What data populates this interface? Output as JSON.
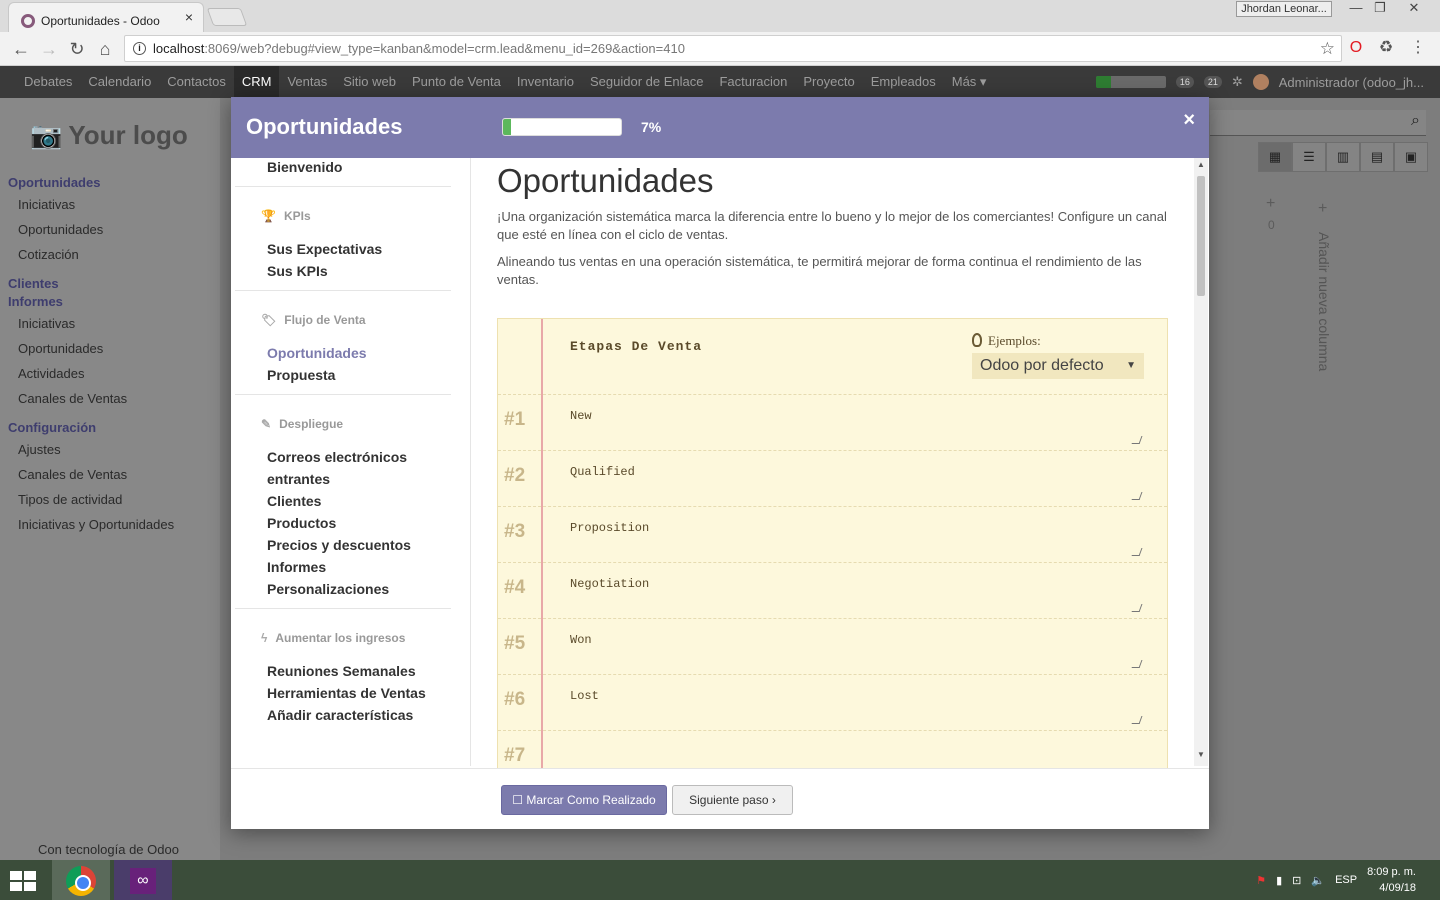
{
  "browser": {
    "tab_title": "Oportunidades - Odoo",
    "tab_close": "×",
    "user_badge": "Jhordan Leonar...",
    "url_host": "localhost",
    "url_rest": ":8069/web?debug#view_type=kanban&model=crm.lead&menu_id=269&action=410",
    "win_min": "—",
    "win_max": "❐",
    "win_close": "✕"
  },
  "odoo_nav": {
    "menus": [
      "Debates",
      "Calendario",
      "Contactos",
      "CRM",
      "Ventas",
      "Sitio web",
      "Punto de Venta",
      "Inventario",
      "Seguidor de Enlace",
      "Facturacion",
      "Proyecto",
      "Empleados",
      "Más ▾"
    ],
    "active_index": 3,
    "progress_fraction": 0.07,
    "badge_messages": "16",
    "badge_chat": "21",
    "user": "Administrador (odoo_jh..."
  },
  "sidebar": {
    "logo": "Your logo",
    "sections": [
      {
        "title": "Oportunidades",
        "items": [
          "Iniciativas",
          "Oportunidades",
          "Cotización"
        ]
      },
      {
        "title": "Clientes",
        "items": []
      },
      {
        "title": "Informes",
        "items": [
          "Iniciativas",
          "Oportunidades",
          "Actividades",
          "Canales de Ventas"
        ]
      },
      {
        "title": "Configuración",
        "items": [
          "Ajustes",
          "Canales de Ventas",
          "Tipos de actividad",
          "Iniciativas y Oportunidades"
        ]
      }
    ],
    "powered_by": "Con tecnología de Odoo"
  },
  "background": {
    "column_count": "0",
    "add_column": "Añadir nueva columna"
  },
  "modal": {
    "title": "Oportunidades",
    "progress_percent": 7,
    "progress_label": "7%",
    "close": "×",
    "nav": {
      "welcome": "Bienvenido",
      "groups": [
        {
          "title": "KPIs",
          "icon": "trophy-icon",
          "items": [
            "Sus Expectativas",
            "Sus KPIs"
          ]
        },
        {
          "title": "Flujo de Venta",
          "icon": "tag-icon",
          "items": [
            "Oportunidades",
            "Propuesta"
          ]
        },
        {
          "title": "Despliegue",
          "icon": "wand-icon",
          "items": [
            "Correos electrónicos",
            "entrantes",
            "Clientes",
            "Productos",
            "Precios y descuentos",
            "Informes",
            "Personalizaciones"
          ]
        },
        {
          "title": "Aumentar los ingresos",
          "icon": "bolt-icon",
          "items": [
            "Reuniones Semanales",
            "Herramientas de Ventas",
            "Añadir características"
          ]
        }
      ]
    },
    "content": {
      "heading": "Oportunidades",
      "para1": "¡Una organización sistemática marca la diferencia entre lo bueno y lo mejor de los comerciantes! Configure un canal que esté en línea con el ciclo de ventas.",
      "para2": "Alineando tus ventas en una operación sistemática, te permitirá mejorar de forma continua el rendimiento de las ventas.",
      "sheet_title": "Etapas De Venta",
      "examples_label": "Ejemplos:",
      "examples_selected": "Odoo por defecto",
      "stages": [
        {
          "num": "#1",
          "value": "New"
        },
        {
          "num": "#2",
          "value": "Qualified"
        },
        {
          "num": "#3",
          "value": "Proposition"
        },
        {
          "num": "#4",
          "value": "Negotiation"
        },
        {
          "num": "#5",
          "value": "Won"
        },
        {
          "num": "#6",
          "value": "Lost"
        },
        {
          "num": "#7",
          "value": ""
        }
      ]
    },
    "footer": {
      "done_button": "☐ Marcar Como Realizado",
      "next_button": "Siguiente paso ›"
    }
  },
  "taskbar": {
    "lang": "ESP",
    "time": "8:09 p. m.",
    "date": "4/09/18"
  }
}
